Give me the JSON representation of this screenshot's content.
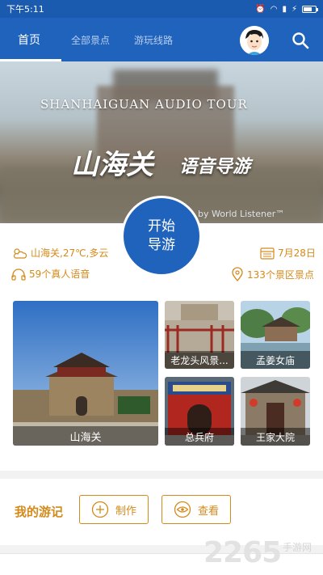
{
  "status_bar": {
    "time": "下午5:11"
  },
  "nav": {
    "tabs": [
      {
        "label": "首页",
        "active": true
      },
      {
        "label": "全部景点",
        "active": false
      },
      {
        "label": "游玩线路",
        "active": false
      }
    ],
    "avatar_icon": "user-avatar-icon",
    "search_icon": "search-icon"
  },
  "hero": {
    "title_en": "SHANHAIGUAN AUDIO TOUR",
    "title_cn_main": "山海关",
    "title_cn_sub": "语音导游",
    "credit": "by World Listener™"
  },
  "start_button": {
    "line1": "开始",
    "line2": "导游"
  },
  "info": {
    "weather": "山海关,27℃,多云",
    "date": "7月28日",
    "voices": "59个真人语音",
    "spots": "133个景区景点"
  },
  "attractions": [
    {
      "label": "山海关"
    },
    {
      "label": "老龙头风景..."
    },
    {
      "label": "孟姜女庙"
    },
    {
      "label": "总兵府"
    },
    {
      "label": "王家大院"
    }
  ],
  "journal": {
    "title": "我的游记",
    "create_label": "制作",
    "view_label": "查看"
  },
  "watermark": {
    "number": "2265",
    "text": "手游网"
  },
  "colors": {
    "primary": "#1f63bd",
    "accent": "#d48a1a"
  }
}
